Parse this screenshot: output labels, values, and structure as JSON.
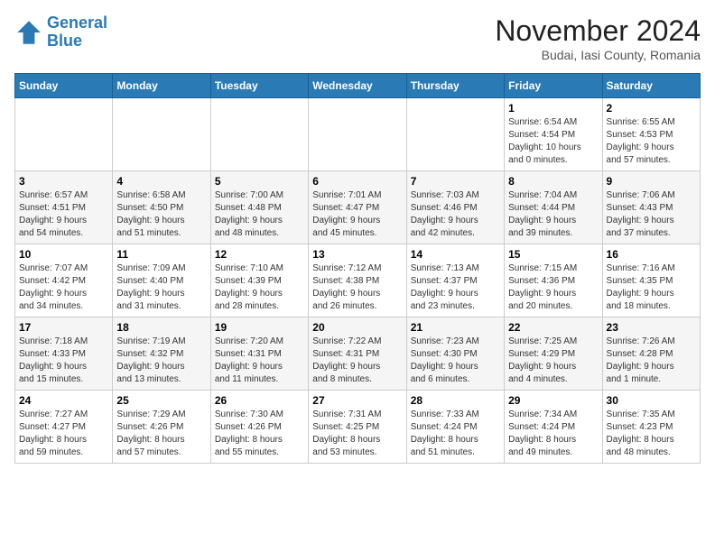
{
  "logo": {
    "line1": "General",
    "line2": "Blue"
  },
  "title": "November 2024",
  "location": "Budai, Iasi County, Romania",
  "days_of_week": [
    "Sunday",
    "Monday",
    "Tuesday",
    "Wednesday",
    "Thursday",
    "Friday",
    "Saturday"
  ],
  "weeks": [
    [
      {
        "day": "",
        "info": ""
      },
      {
        "day": "",
        "info": ""
      },
      {
        "day": "",
        "info": ""
      },
      {
        "day": "",
        "info": ""
      },
      {
        "day": "",
        "info": ""
      },
      {
        "day": "1",
        "info": "Sunrise: 6:54 AM\nSunset: 4:54 PM\nDaylight: 10 hours\nand 0 minutes."
      },
      {
        "day": "2",
        "info": "Sunrise: 6:55 AM\nSunset: 4:53 PM\nDaylight: 9 hours\nand 57 minutes."
      }
    ],
    [
      {
        "day": "3",
        "info": "Sunrise: 6:57 AM\nSunset: 4:51 PM\nDaylight: 9 hours\nand 54 minutes."
      },
      {
        "day": "4",
        "info": "Sunrise: 6:58 AM\nSunset: 4:50 PM\nDaylight: 9 hours\nand 51 minutes."
      },
      {
        "day": "5",
        "info": "Sunrise: 7:00 AM\nSunset: 4:48 PM\nDaylight: 9 hours\nand 48 minutes."
      },
      {
        "day": "6",
        "info": "Sunrise: 7:01 AM\nSunset: 4:47 PM\nDaylight: 9 hours\nand 45 minutes."
      },
      {
        "day": "7",
        "info": "Sunrise: 7:03 AM\nSunset: 4:46 PM\nDaylight: 9 hours\nand 42 minutes."
      },
      {
        "day": "8",
        "info": "Sunrise: 7:04 AM\nSunset: 4:44 PM\nDaylight: 9 hours\nand 39 minutes."
      },
      {
        "day": "9",
        "info": "Sunrise: 7:06 AM\nSunset: 4:43 PM\nDaylight: 9 hours\nand 37 minutes."
      }
    ],
    [
      {
        "day": "10",
        "info": "Sunrise: 7:07 AM\nSunset: 4:42 PM\nDaylight: 9 hours\nand 34 minutes."
      },
      {
        "day": "11",
        "info": "Sunrise: 7:09 AM\nSunset: 4:40 PM\nDaylight: 9 hours\nand 31 minutes."
      },
      {
        "day": "12",
        "info": "Sunrise: 7:10 AM\nSunset: 4:39 PM\nDaylight: 9 hours\nand 28 minutes."
      },
      {
        "day": "13",
        "info": "Sunrise: 7:12 AM\nSunset: 4:38 PM\nDaylight: 9 hours\nand 26 minutes."
      },
      {
        "day": "14",
        "info": "Sunrise: 7:13 AM\nSunset: 4:37 PM\nDaylight: 9 hours\nand 23 minutes."
      },
      {
        "day": "15",
        "info": "Sunrise: 7:15 AM\nSunset: 4:36 PM\nDaylight: 9 hours\nand 20 minutes."
      },
      {
        "day": "16",
        "info": "Sunrise: 7:16 AM\nSunset: 4:35 PM\nDaylight: 9 hours\nand 18 minutes."
      }
    ],
    [
      {
        "day": "17",
        "info": "Sunrise: 7:18 AM\nSunset: 4:33 PM\nDaylight: 9 hours\nand 15 minutes."
      },
      {
        "day": "18",
        "info": "Sunrise: 7:19 AM\nSunset: 4:32 PM\nDaylight: 9 hours\nand 13 minutes."
      },
      {
        "day": "19",
        "info": "Sunrise: 7:20 AM\nSunset: 4:31 PM\nDaylight: 9 hours\nand 11 minutes."
      },
      {
        "day": "20",
        "info": "Sunrise: 7:22 AM\nSunset: 4:31 PM\nDaylight: 9 hours\nand 8 minutes."
      },
      {
        "day": "21",
        "info": "Sunrise: 7:23 AM\nSunset: 4:30 PM\nDaylight: 9 hours\nand 6 minutes."
      },
      {
        "day": "22",
        "info": "Sunrise: 7:25 AM\nSunset: 4:29 PM\nDaylight: 9 hours\nand 4 minutes."
      },
      {
        "day": "23",
        "info": "Sunrise: 7:26 AM\nSunset: 4:28 PM\nDaylight: 9 hours\nand 1 minute."
      }
    ],
    [
      {
        "day": "24",
        "info": "Sunrise: 7:27 AM\nSunset: 4:27 PM\nDaylight: 8 hours\nand 59 minutes."
      },
      {
        "day": "25",
        "info": "Sunrise: 7:29 AM\nSunset: 4:26 PM\nDaylight: 8 hours\nand 57 minutes."
      },
      {
        "day": "26",
        "info": "Sunrise: 7:30 AM\nSunset: 4:26 PM\nDaylight: 8 hours\nand 55 minutes."
      },
      {
        "day": "27",
        "info": "Sunrise: 7:31 AM\nSunset: 4:25 PM\nDaylight: 8 hours\nand 53 minutes."
      },
      {
        "day": "28",
        "info": "Sunrise: 7:33 AM\nSunset: 4:24 PM\nDaylight: 8 hours\nand 51 minutes."
      },
      {
        "day": "29",
        "info": "Sunrise: 7:34 AM\nSunset: 4:24 PM\nDaylight: 8 hours\nand 49 minutes."
      },
      {
        "day": "30",
        "info": "Sunrise: 7:35 AM\nSunset: 4:23 PM\nDaylight: 8 hours\nand 48 minutes."
      }
    ]
  ]
}
